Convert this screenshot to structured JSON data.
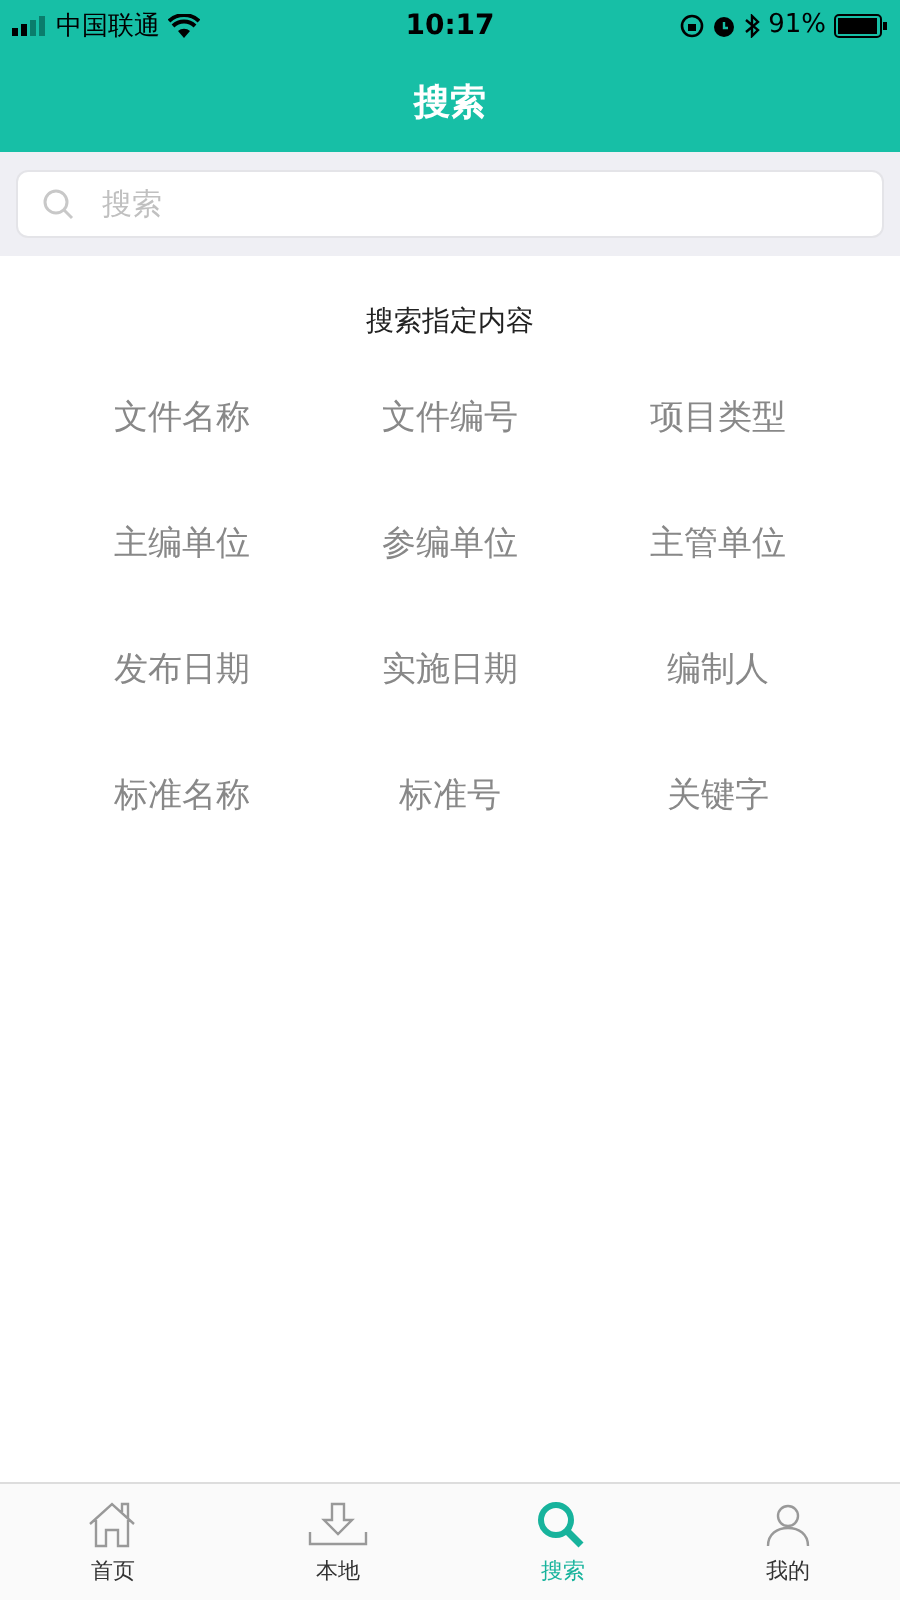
{
  "status_bar": {
    "carrier": "中国联通",
    "time": "10:17",
    "battery": "91%"
  },
  "header": {
    "title": "搜索"
  },
  "search": {
    "placeholder": "搜索"
  },
  "section": {
    "title": "搜索指定内容",
    "options": [
      "文件名称",
      "文件编号",
      "项目类型",
      "主编单位",
      "参编单位",
      "主管单位",
      "发布日期",
      "实施日期",
      "编制人",
      "标准名称",
      "标准号",
      "关键字"
    ]
  },
  "tab_bar": [
    {
      "label": "首页",
      "kind": "home",
      "selected": false
    },
    {
      "label": "本地",
      "kind": "download",
      "selected": false
    },
    {
      "label": "搜索",
      "kind": "search",
      "selected": true
    },
    {
      "label": "我的",
      "kind": "profile",
      "selected": false
    }
  ]
}
